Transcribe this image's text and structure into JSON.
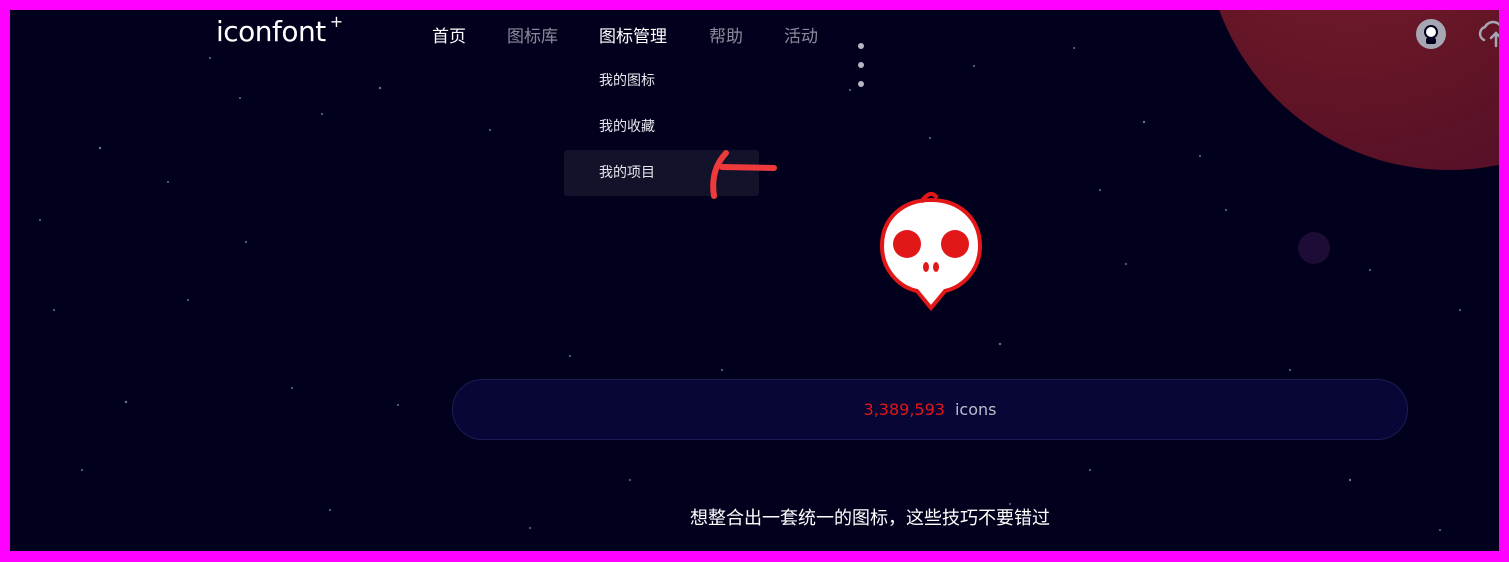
{
  "app": {
    "logo_text": "iconfont",
    "logo_mark": "+"
  },
  "nav": {
    "items": [
      {
        "label": "首页",
        "active": true
      },
      {
        "label": "图标库",
        "active": false
      },
      {
        "label": "图标管理",
        "active": true
      },
      {
        "label": "帮助",
        "active": false
      },
      {
        "label": "活动",
        "active": false
      }
    ],
    "more_icon": "more-dots-icon"
  },
  "dropdown": {
    "items": [
      {
        "label": "我的图标"
      },
      {
        "label": "我的收藏"
      },
      {
        "label": "我的项目",
        "highlighted": true
      }
    ]
  },
  "header_right": {
    "avatar_icon": "user-avatar-icon",
    "upload_icon": "cloud-upload-icon"
  },
  "search": {
    "count": "3,389,593",
    "unit": "icons"
  },
  "tagline": "想整合出一套统一的图标，这些技巧不要错过",
  "colors": {
    "background": "#02011d",
    "frame": "#ff00ff",
    "accent_red": "#e21717",
    "annotation_arrow": "#ee3a3a"
  }
}
